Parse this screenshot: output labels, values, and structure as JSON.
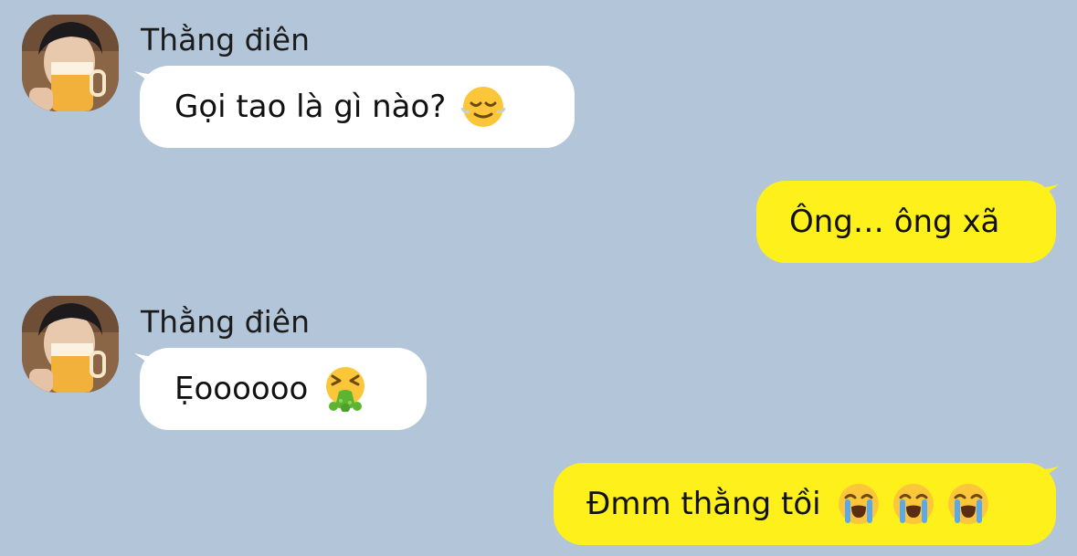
{
  "chat": {
    "messages": [
      {
        "direction": "incoming",
        "sender": "Thằng điên",
        "text": "Gọi tao là gì nào?",
        "emojis": [
          "relieved-face"
        ]
      },
      {
        "direction": "outgoing",
        "text": "Ông… ông xã",
        "emojis": []
      },
      {
        "direction": "incoming",
        "sender": "Thằng điên",
        "text": "Ẹoooooo",
        "emojis": [
          "vomiting-face"
        ]
      },
      {
        "direction": "outgoing",
        "text": "Đmm thằng tồi",
        "emojis": [
          "loudly-crying-face",
          "loudly-crying-face",
          "loudly-crying-face"
        ]
      }
    ]
  },
  "colors": {
    "background": "#b3c5d8",
    "incoming_bubble": "#ffffff",
    "outgoing_bubble": "#fef01b"
  }
}
